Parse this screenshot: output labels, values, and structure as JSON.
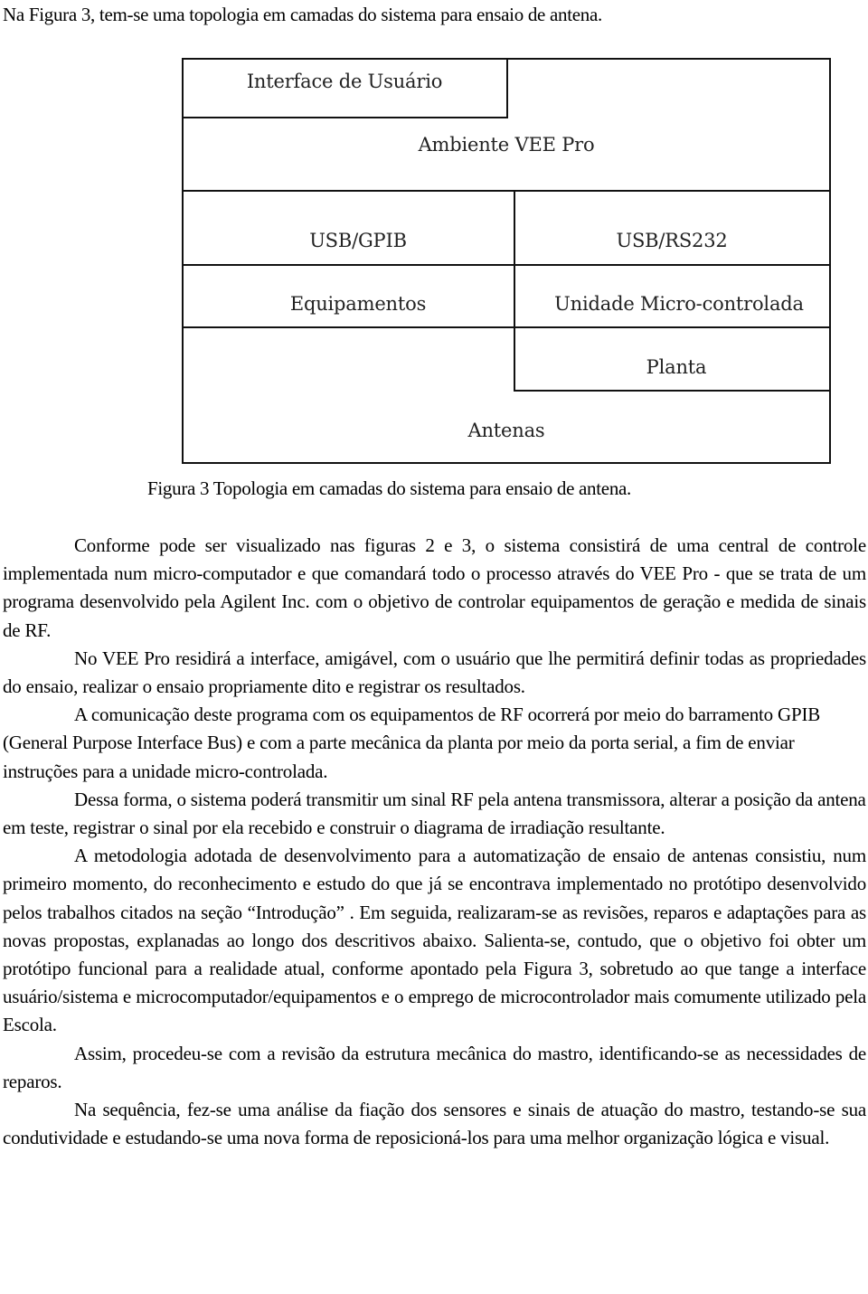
{
  "intro": "Na Figura 3, tem-se uma topologia em camadas do sistema para ensaio de antena.",
  "figure": {
    "layers": {
      "interface": "Interface de Usuário",
      "ambiente": "Ambiente VEE Pro",
      "usb_gpib": "USB/GPIB",
      "usb_rs232": "USB/RS232",
      "equipamentos": "Equipamentos",
      "unidade": "Unidade Micro-controlada",
      "planta": "Planta",
      "antenas": "Antenas"
    },
    "caption": "Figura 3 Topologia em camadas do sistema para ensaio de antena."
  },
  "paragraphs": [
    "Conforme pode ser visualizado nas figuras 2 e 3, o sistema consistirá de uma central de controle implementada num micro-computador e que comandará todo o processo através do VEE Pro - que se trata de um programa desenvolvido pela Agilent Inc. com o objetivo de controlar equipamentos de geração e medida de sinais de RF.",
    "No VEE Pro residirá a interface, amigável, com o usuário que lhe permitirá definir todas as propriedades do ensaio, realizar o ensaio propriamente dito e registrar os resultados.",
    "A comunicação deste programa com os equipamentos de RF ocorrerá por meio do barramento GPIB (General Purpose Interface Bus) e com a parte mecânica da planta por meio da porta serial, a fim de enviar instruções para a unidade micro-controlada.",
    "Dessa forma, o sistema poderá transmitir um sinal RF pela antena transmissora, alterar a posição da antena em teste, registrar o sinal por ela recebido e construir o diagrama de irradiação resultante.",
    "A metodologia adotada de desenvolvimento para a automatização de ensaio de antenas consistiu, num primeiro momento, do reconhecimento e estudo do que já se encontrava implementado no protótipo desenvolvido pelos trabalhos citados na seção “Introdução” . Em seguida, realizaram-se as revisões, reparos e adaptações para as novas propostas, explanadas ao longo dos descritivos abaixo. Salienta-se, contudo, que o objetivo foi obter um protótipo funcional para a realidade atual, conforme apontado pela Figura 3, sobretudo ao que tange a interface usuário/sistema e microcomputador/equipamentos e o emprego de microcontrolador mais comumente utilizado pela Escola.",
    "Assim, procedeu-se com a revisão da estrutura mecânica do mastro, identificando-se as necessidades de reparos.",
    "Na sequência, fez-se uma análise da fiação dos sensores e sinais de atuação do mastro, testando-se sua condutividade e estudando-se uma nova forma de reposicioná-los para uma melhor organização lógica e visual."
  ]
}
